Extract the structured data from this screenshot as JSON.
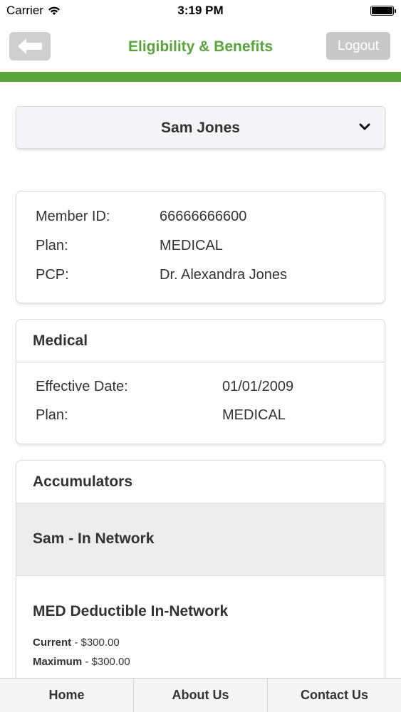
{
  "status_bar": {
    "carrier": "Carrier",
    "time": "3:19 PM",
    "battery_level": 1.0
  },
  "header": {
    "title": "Eligibility & Benefits",
    "logout_label": "Logout",
    "back_icon": "arrow-left-icon",
    "accent_color": "#5aa43c"
  },
  "member_select": {
    "selected": "Sam Jones"
  },
  "member_info": {
    "rows": [
      {
        "label": "Member ID:",
        "value": "66666666600"
      },
      {
        "label": "Plan:",
        "value": "MEDICAL"
      },
      {
        "label": "PCP:",
        "value": "Dr. Alexandra Jones"
      }
    ]
  },
  "medical": {
    "title": "Medical",
    "rows": [
      {
        "label": "Effective Date:",
        "value": "01/01/2009"
      },
      {
        "label": "Plan:",
        "value": "MEDICAL"
      }
    ]
  },
  "accumulators": {
    "title": "Accumulators",
    "section": "Sam - In Network",
    "item_title": "MED Deductible In-Network",
    "current_label": "Current",
    "current_value": " - $300.00",
    "maximum_label": "Maximum",
    "maximum_value": " - $300.00"
  },
  "tabbar": {
    "home": "Home",
    "about": "About Us",
    "contact": "Contact Us"
  }
}
